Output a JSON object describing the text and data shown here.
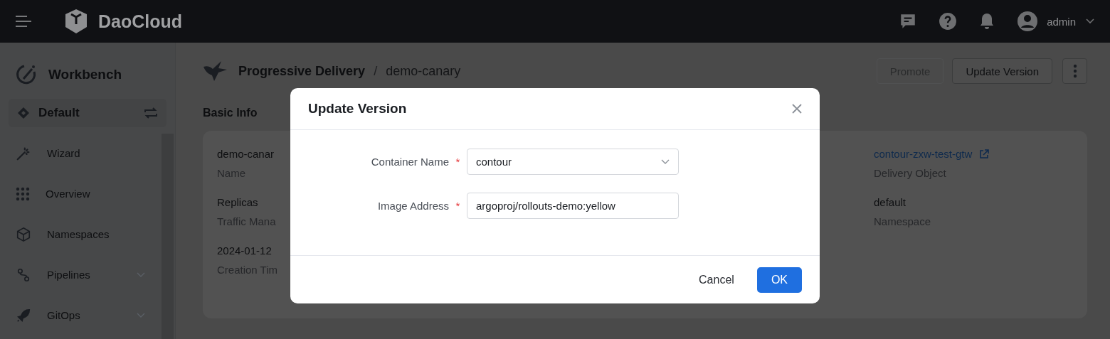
{
  "header": {
    "brand": "DaoCloud",
    "user": "admin"
  },
  "sidebar": {
    "title": "Workbench",
    "workspace": "Default",
    "items": [
      {
        "label": "Wizard",
        "expandable": false
      },
      {
        "label": "Overview",
        "expandable": false
      },
      {
        "label": "Namespaces",
        "expandable": false
      },
      {
        "label": "Pipelines",
        "expandable": true
      },
      {
        "label": "GitOps",
        "expandable": true
      }
    ]
  },
  "breadcrumb": {
    "module": "Progressive Delivery",
    "separator": "/",
    "current": "demo-canary"
  },
  "actions": [
    {
      "label": "Promote",
      "disabled": true
    },
    {
      "label": "Update Version",
      "disabled": false
    }
  ],
  "section_title": "Basic Info",
  "fields_left": [
    {
      "value": "demo-canar",
      "label": "Name"
    },
    {
      "value": "Replicas",
      "label": "Traffic Mana"
    },
    {
      "value": "2024-01-12",
      "label": "Creation Tim"
    }
  ],
  "fields_right": [
    {
      "value": "contour-zxw-test-gtw",
      "label": "Delivery Object",
      "kind": "link"
    },
    {
      "value": "default",
      "label": "Namespace",
      "kind": "text"
    }
  ],
  "dialog": {
    "title": "Update Version",
    "fields": [
      {
        "label": "Container Name",
        "required": true,
        "required_mark": "*",
        "value": "contour",
        "kind": "select"
      },
      {
        "label": "Image Address",
        "required": true,
        "required_mark": "*",
        "value": "argoproj/rollouts-demo:yellow",
        "kind": "input"
      }
    ],
    "cancel": "Cancel",
    "ok": "OK"
  }
}
